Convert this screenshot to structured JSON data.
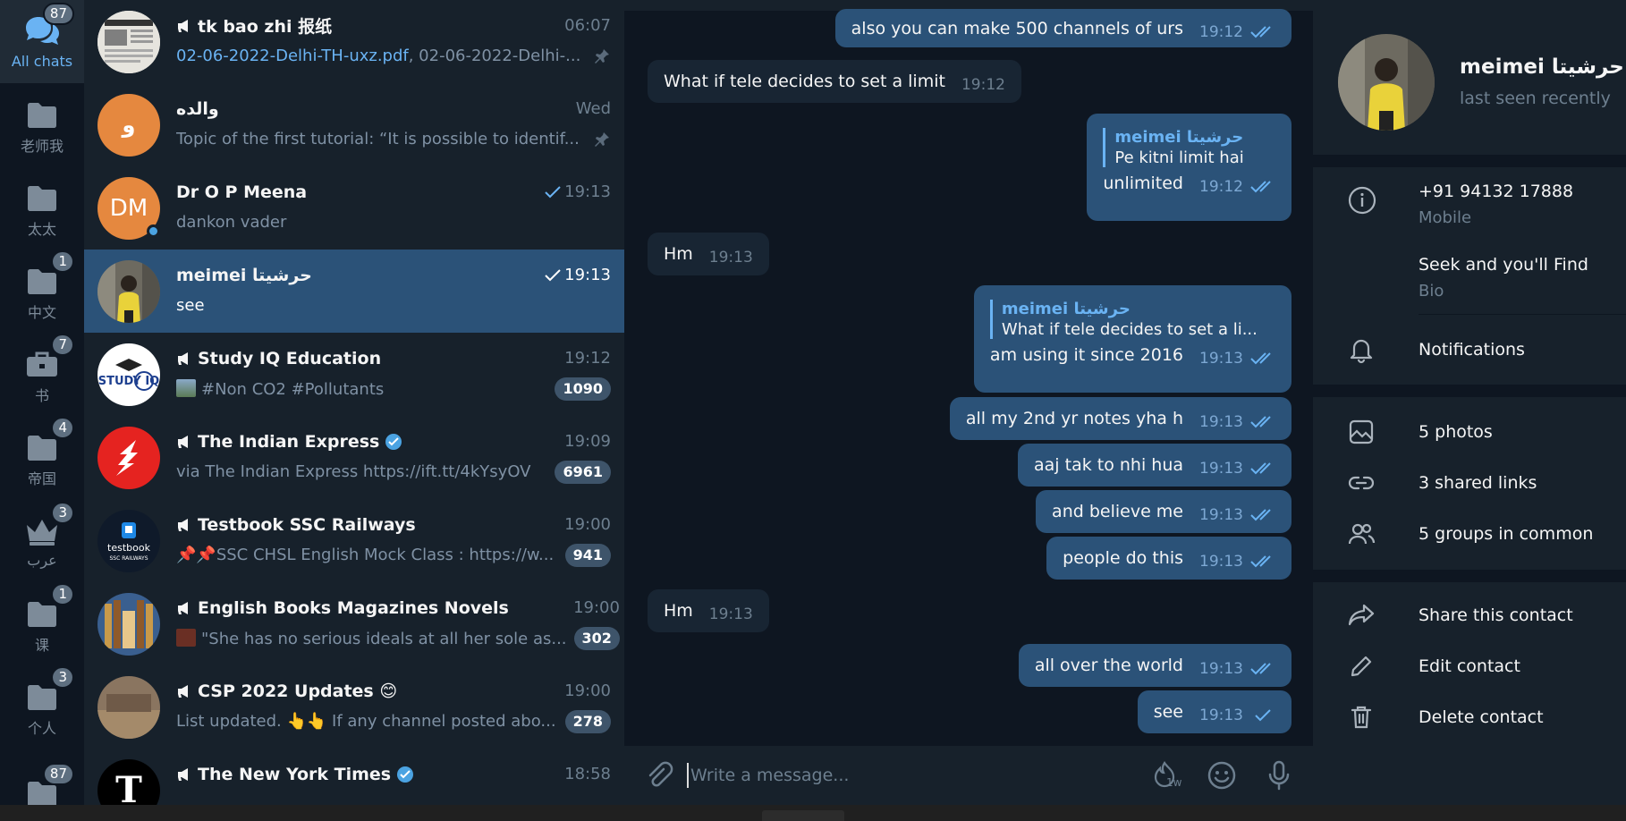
{
  "folders": [
    {
      "name": "All chats",
      "badge": "87",
      "icon": "chats-icon",
      "active": true
    },
    {
      "name": "老师我",
      "badge": "",
      "icon": "folder-icon"
    },
    {
      "name": "太太",
      "badge": "",
      "icon": "folder-icon"
    },
    {
      "name": "中文",
      "badge": "1",
      "icon": "folder-icon"
    },
    {
      "name": "书",
      "badge": "7",
      "icon": "briefcase-icon"
    },
    {
      "name": "帝国",
      "badge": "4",
      "icon": "folder-icon"
    },
    {
      "name": "عرب",
      "badge": "3",
      "icon": "crown-icon"
    },
    {
      "name": "课",
      "badge": "1",
      "icon": "folder-icon"
    },
    {
      "name": "个人",
      "badge": "3",
      "icon": "folder-icon"
    },
    {
      "name": "",
      "badge": "87",
      "icon": "folder-icon"
    }
  ],
  "chats": [
    {
      "name": "tk bao zhi 报纸",
      "time": "06:07",
      "preview_link": "02-06-2022-Delhi-TH-uxz.pdf",
      "preview": ", 02-06-2022-Delhi-...",
      "channel": true,
      "pinned": true
    },
    {
      "name": "والده",
      "time": "Wed",
      "avatar_letter": "و",
      "avatar_color": "#e5883f",
      "preview": "Topic of the first tutorial: “It is possible to identif...",
      "pinned": true
    },
    {
      "name": "Dr O P Meena",
      "time": "19:13",
      "avatar_letter": "DM",
      "avatar_color": "#e5883f",
      "preview": "dankon vader",
      "read": true,
      "online": true
    },
    {
      "name": "meimei حرشيتا",
      "time": "19:13",
      "preview": "see",
      "read": true,
      "active": true
    },
    {
      "name": "Study IQ Education",
      "time": "19:12",
      "preview": "#Non CO2 #Pollutants",
      "count": "1090",
      "channel": true,
      "thumb": true
    },
    {
      "name": "The Indian Express",
      "time": "19:09",
      "preview": "via The Indian Express https://ift.tt/4kYsyOV",
      "count": "6961",
      "channel": true,
      "verified": true
    },
    {
      "name": "Testbook SSC Railways",
      "time": "19:00",
      "preview": "📌📌SSC CHSL English Mock Class : https://w...",
      "count": "941",
      "channel": true
    },
    {
      "name": "English Books Magazines Novels",
      "time": "19:00",
      "preview": "\"She has no serious ideals at all her sole as...",
      "count": "302",
      "channel": true,
      "thumb": true
    },
    {
      "name": "CSP 2022 Updates 😊",
      "time": "19:00",
      "preview": "List updated. 👆👆 If any channel posted abo...",
      "count": "278",
      "channel": true
    },
    {
      "name": "The New York Times",
      "time": "18:58",
      "preview": "",
      "channel": true,
      "verified": true
    }
  ],
  "messages": [
    {
      "dir": "out",
      "text": "also you can make 500 channels of urs",
      "time": "19:12",
      "checks": "double"
    },
    {
      "dir": "in",
      "text": "What if tele decides to set a limit",
      "time": "19:12"
    },
    {
      "dir": "out",
      "reply_name": "meimei حرشيتا",
      "reply_text": "Pe kitni limit hai",
      "text": "unlimited",
      "time": "19:12",
      "checks": "double"
    },
    {
      "dir": "in",
      "text": "Hm",
      "time": "19:13"
    },
    {
      "dir": "out",
      "reply_name": "meimei حرشيتا",
      "reply_text": "What if tele decides to set a li...",
      "text": "am using it since 2016",
      "time": "19:13",
      "checks": "double"
    },
    {
      "dir": "out",
      "text": "all my 2nd yr notes yha h",
      "time": "19:13",
      "checks": "double"
    },
    {
      "dir": "out",
      "text": "aaj tak to nhi hua",
      "time": "19:13",
      "checks": "double"
    },
    {
      "dir": "out",
      "text": "and believe me",
      "time": "19:13",
      "checks": "double"
    },
    {
      "dir": "out",
      "text": "people do this",
      "time": "19:13",
      "checks": "double"
    },
    {
      "dir": "in",
      "text": "Hm",
      "time": "19:13"
    },
    {
      "dir": "out",
      "text": "all over the world",
      "time": "19:13",
      "checks": "double"
    },
    {
      "dir": "out",
      "text": "see",
      "time": "19:13",
      "checks": "single"
    }
  ],
  "composer": {
    "placeholder": "Write a message...",
    "timer_label": "1w"
  },
  "profile": {
    "name": "meimei حرشيتا",
    "status": "last seen recently",
    "phone": "+91 94132 17888",
    "phone_label": "Mobile",
    "bio": "Seek and you'll Find",
    "bio_label": "Bio",
    "notifications": "Notifications",
    "photos": "5 photos",
    "links": "3 shared links",
    "groups": "5 groups in common",
    "share": "Share this contact",
    "edit": "Edit contact",
    "delete": "Delete contact"
  },
  "colors": {
    "accent": "#6ab3f3",
    "outgoing": "#2b5278",
    "incoming": "#182533",
    "sidebar": "#17212b",
    "background": "#0e1621"
  }
}
